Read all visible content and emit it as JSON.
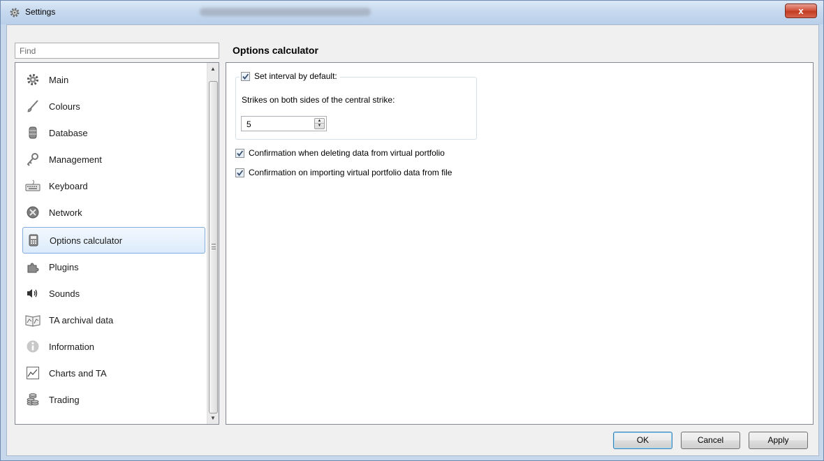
{
  "window": {
    "title": "Settings",
    "close_label": "x"
  },
  "search": {
    "placeholder": "Find"
  },
  "sidebar": {
    "items": [
      {
        "label": "Main",
        "icon": "gear-icon"
      },
      {
        "label": "Colours",
        "icon": "brush-icon"
      },
      {
        "label": "Database",
        "icon": "database-icon"
      },
      {
        "label": "Management",
        "icon": "key-icon"
      },
      {
        "label": "Keyboard",
        "icon": "keyboard-icon"
      },
      {
        "label": "Network",
        "icon": "network-icon"
      },
      {
        "label": "Options calculator",
        "icon": "calculator-icon",
        "selected": true
      },
      {
        "label": "Plugins",
        "icon": "puzzle-icon"
      },
      {
        "label": "Sounds",
        "icon": "speaker-icon"
      },
      {
        "label": "TA archival data",
        "icon": "archive-chart-icon"
      },
      {
        "label": "Information",
        "icon": "info-icon"
      },
      {
        "label": "Charts and TA",
        "icon": "line-chart-icon"
      },
      {
        "label": "Trading",
        "icon": "coins-icon"
      }
    ]
  },
  "main": {
    "section_title": "Options calculator",
    "interval": {
      "checkbox_label": "Set interval by default:",
      "checked": true,
      "strikes_label": "Strikes on both sides of the central strike:",
      "strikes_value": "5"
    },
    "options": [
      {
        "label": "Confirmation when deleting data from virtual portfolio",
        "checked": true
      },
      {
        "label": "Confirmation on importing virtual portfolio data from file",
        "checked": true
      }
    ]
  },
  "buttons": {
    "ok": "OK",
    "cancel": "Cancel",
    "apply": "Apply"
  },
  "colors": {
    "selection_border": "#84acdd",
    "titlebar": "#c5d8ee",
    "close": "#c23b22"
  }
}
